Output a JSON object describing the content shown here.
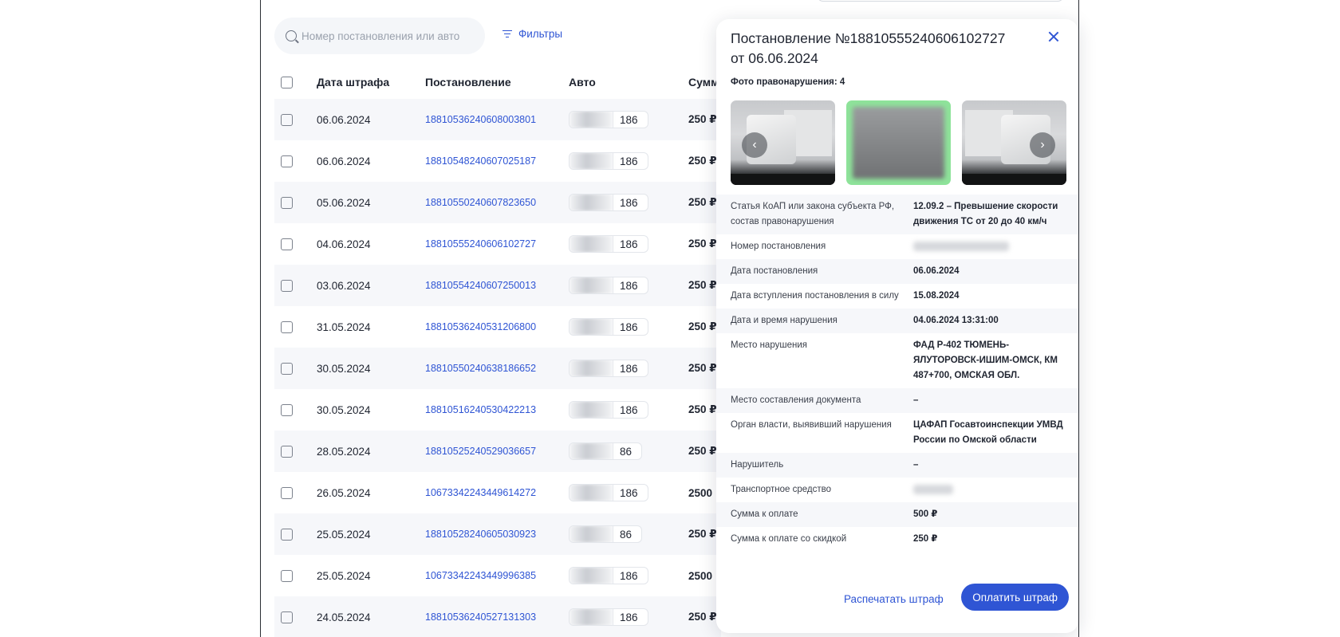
{
  "search": {
    "placeholder": "Номер постановления или авто"
  },
  "filters": {
    "label": "Фильтры"
  },
  "table": {
    "headers": {
      "date": "Дата штрафа",
      "post": "Постановление",
      "auto": "Авто",
      "sum": "Сумм"
    },
    "rows": [
      {
        "date": "06.06.2024",
        "post": "18810536240608003801",
        "region": "186",
        "sum": "250 ₽"
      },
      {
        "date": "06.06.2024",
        "post": "18810548240607025187",
        "region": "186",
        "sum": "250 ₽"
      },
      {
        "date": "05.06.2024",
        "post": "18810550240607823650",
        "region": "186",
        "sum": "250 ₽"
      },
      {
        "date": "04.06.2024",
        "post": "18810555240606102727",
        "region": "186",
        "sum": "250 ₽"
      },
      {
        "date": "03.06.2024",
        "post": "18810554240607250013",
        "region": "186",
        "sum": "250 ₽"
      },
      {
        "date": "31.05.2024",
        "post": "18810536240531206800",
        "region": "186",
        "sum": "250 ₽"
      },
      {
        "date": "30.05.2024",
        "post": "18810550240638186652",
        "region": "186",
        "sum": "250 ₽"
      },
      {
        "date": "30.05.2024",
        "post": "18810516240530422213",
        "region": "186",
        "sum": "250 ₽"
      },
      {
        "date": "28.05.2024",
        "post": "18810525240529036657",
        "region": "86",
        "sum": "250 ₽"
      },
      {
        "date": "26.05.2024",
        "post": "10673342243449614272",
        "region": "186",
        "sum": "2500"
      },
      {
        "date": "25.05.2024",
        "post": "18810528240605030923",
        "region": "86",
        "sum": "250 ₽"
      },
      {
        "date": "25.05.2024",
        "post": "10673342243449996385",
        "region": "186",
        "sum": "2500"
      },
      {
        "date": "24.05.2024",
        "post": "18810536240527131303",
        "region": "186",
        "sum": "250 ₽"
      }
    ]
  },
  "panel": {
    "title": "Постановление №18810555240606102727 от 06.06.2024",
    "photos_label": "Фото правонарушения: 4",
    "details": [
      {
        "key": "Статья КоАП или закона субъекта РФ, состав правонарушения",
        "value": "12.09.2 – Превышение скорости движения ТС от 20 до 40 км/ч"
      },
      {
        "key": "Номер постановления",
        "value": ""
      },
      {
        "key": "Дата постановления",
        "value": "06.06.2024"
      },
      {
        "key": "Дата вступления постановления в силу",
        "value": "15.08.2024"
      },
      {
        "key": "Дата и время нарушения",
        "value": "04.06.2024 13:31:00"
      },
      {
        "key": "Место нарушения",
        "value": "ФАД Р-402 ТЮМЕНЬ-ЯЛУТОРОВСК-ИШИМ-ОМСК, КМ 487+700, ОМСКАЯ ОБЛ."
      },
      {
        "key": "Место составления документа",
        "value": "–"
      },
      {
        "key": "Орган власти, выявивший нарушения",
        "value": "ЦАФАП Госавтоинспекции УМВД России по Омской области"
      },
      {
        "key": "Нарушитель",
        "value": "–"
      },
      {
        "key": "Транспортное средство",
        "value": ""
      },
      {
        "key": "Сумма к оплате",
        "value": "500 ₽"
      },
      {
        "key": "Сумма к оплате со скидкой",
        "value": "250 ₽"
      }
    ],
    "print_label": "Распечатать штраф",
    "pay_label": "Оплатить штраф"
  }
}
